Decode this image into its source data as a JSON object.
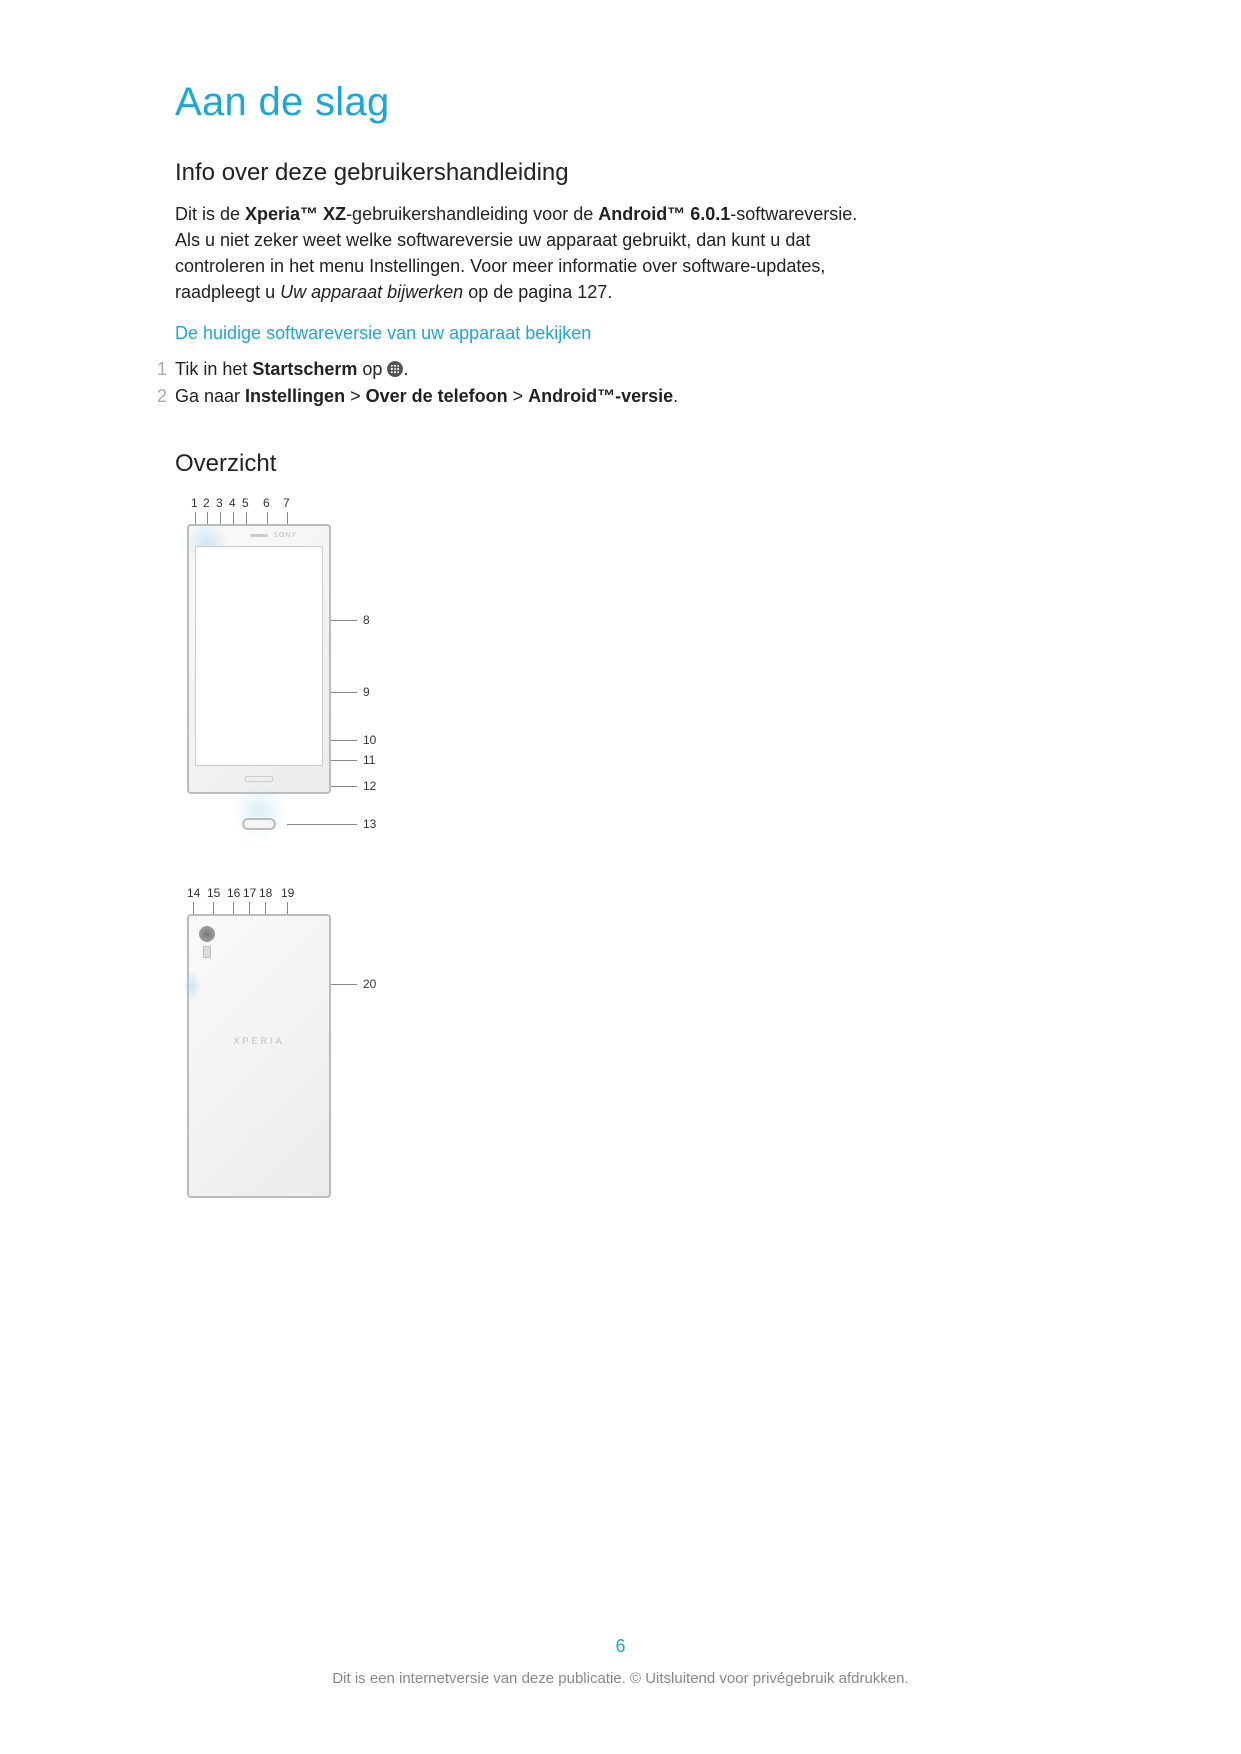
{
  "title": "Aan de slag",
  "section1": {
    "heading": "Info over deze gebruikershandleiding",
    "intro_pre": "Dit is de ",
    "intro_bold1": "Xperia™ XZ",
    "intro_mid1": "-gebruikershandleiding voor de ",
    "intro_bold2": "Android™ 6.0.1",
    "intro_mid2": "-softwareversie. Als u niet zeker weet welke softwareversie uw apparaat gebruikt, dan kunt u dat controleren in het menu Instellingen. Voor meer informatie over software-updates, raadpleegt u ",
    "intro_italic": "Uw apparaat bijwerken",
    "intro_post": " op de pagina 127.",
    "subhead": "De huidige softwareversie van uw apparaat bekijken",
    "steps": [
      {
        "num": "1",
        "pre": "Tik in het ",
        "b1": "Startscherm",
        "mid": " op ",
        "icon": "apps-icon",
        "post": "."
      },
      {
        "num": "2",
        "pre": "Ga naar ",
        "b1": "Instellingen",
        "sep1": " > ",
        "b2": "Over de telefoon",
        "sep2": " > ",
        "b3": "Android™-versie",
        "post": "."
      }
    ]
  },
  "section2": {
    "heading": "Overzicht"
  },
  "diagram_front": {
    "top_labels": [
      "1",
      "2",
      "3",
      "4",
      "5",
      "6",
      "7"
    ],
    "right_labels": [
      "8",
      "9",
      "10",
      "11",
      "12",
      "13"
    ],
    "brand": "SONY"
  },
  "diagram_back": {
    "top_labels": [
      "14",
      "15",
      "16",
      "17",
      "18",
      "19"
    ],
    "right_labels": [
      "20"
    ],
    "brand": "XPERIA"
  },
  "page_number": "6",
  "footer": "Dit is een internetversie van deze publicatie. © Uitsluitend voor privégebruik afdrukken."
}
